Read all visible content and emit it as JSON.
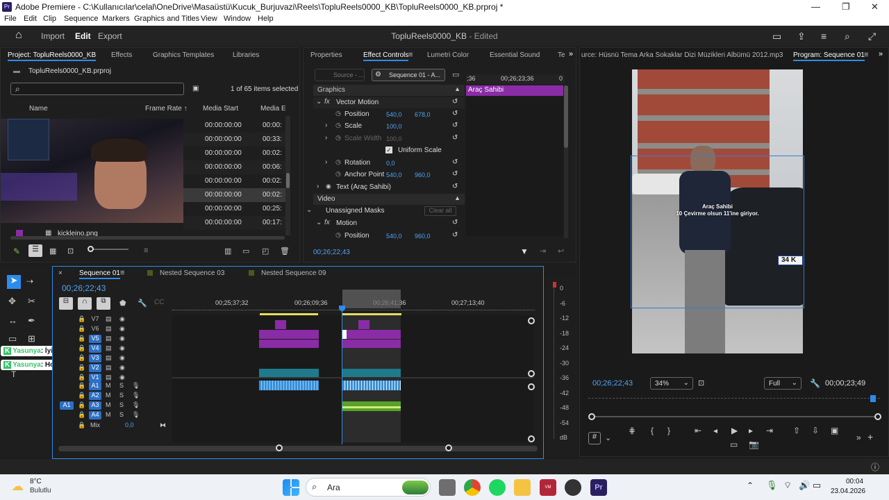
{
  "window": {
    "title": "Adobe Premiere - C:\\Kullanıcılar\\celal\\OneDrive\\Masaüstü\\Kucuk_Burjuvazi\\Reels\\TopluReels0000_KB\\TopluReels0000_KB.prproj *",
    "app_badge": "Pr"
  },
  "menu": [
    "File",
    "Edit",
    "Clip",
    "Sequence",
    "Markers",
    "Graphics and Titles",
    "View",
    "Window",
    "Help"
  ],
  "header": {
    "nav": [
      "Import",
      "Edit",
      "Export"
    ],
    "active": "Edit",
    "project_title": "TopluReels0000_KB",
    "status": " - Edited"
  },
  "project_panel": {
    "tabs": [
      "Project: TopluReels0000_KB",
      "Effects",
      "Graphics Templates",
      "Libraries"
    ],
    "file": "TopluReels0000_KB.prproj",
    "items_selected": "1 of 65 items selected",
    "columns": [
      "Name",
      "Frame Rate",
      "Media Start",
      "Media End"
    ],
    "rows": [
      {
        "start": "00:00:00:00",
        "end": "00:00:"
      },
      {
        "start": "00:00:00:00",
        "end": "00:33:"
      },
      {
        "start": "00:00:00:00",
        "end": "00:02:"
      },
      {
        "start": "00:00:00:00",
        "end": "00:06:"
      },
      {
        "start": "00:00:00:00",
        "end": "00:02:"
      },
      {
        "start": "00:00:00:00",
        "end": "00:02:"
      },
      {
        "start": "00:00:00:00",
        "end": "00:25:"
      },
      {
        "start": "00:00:00:00",
        "end": "00:17:"
      }
    ],
    "last_item": "kickleino.png"
  },
  "effect_controls": {
    "tabs": [
      "Properties",
      "Effect Controls",
      "Lumetri Color",
      "Essential Sound",
      "Te"
    ],
    "source_btn": "Source - ...",
    "sequence_btn": "Sequence 01 - A...",
    "timecode_ruler": "00;26;23;36",
    "ruler_left": ";36",
    "ruler_right": "0",
    "clip_label": "Araç Sahibi",
    "sections": {
      "graphics": "Graphics",
      "vector_motion": "Vector Motion",
      "position_label": "Position",
      "position_x": "540,0",
      "position_y": "678,0",
      "scale_label": "Scale",
      "scale_value": "100,0",
      "scale_width_label": "Scale Width",
      "scale_width_value": "100,0",
      "uniform_scale": "Uniform Scale",
      "rotation_label": "Rotation",
      "rotation_value": "0,0",
      "anchor_label": "Anchor Point",
      "anchor_x": "540,0",
      "anchor_y": "960,0",
      "text_layer": "Text (Araç Sahibi)",
      "video": "Video",
      "unassigned_masks": "Unassigned Masks",
      "clear_all": "Clear all",
      "motion": "Motion",
      "motion_position_label": "Position",
      "motion_position_x": "540,0",
      "motion_position_y": "960,0"
    },
    "current_time": "00;26;22;43"
  },
  "program_monitor": {
    "source_tab": "urce: Hüsnü Tema  Arka Sokaklar Dizi Müzikleri Albümü  2012.mp3",
    "tab": "Program: Sequence 01",
    "overlay_title": "Araç Sahibi",
    "overlay_subtitle": "10 Çevirme olsun 11'ine giriyor.",
    "plate": "34 K",
    "timecode": "00;26;22;43",
    "zoom": "34%",
    "quality": "Full",
    "duration": "00;00;23;49"
  },
  "timeline": {
    "tabs": [
      "Sequence 01",
      "Nested Sequence 03",
      "Nested Sequence 09"
    ],
    "timecode": "00;26;22;43",
    "ruler": [
      "00;25;37;32",
      "00;26;09;36",
      "00;26;41;36",
      "00;27;13;40"
    ],
    "video_tracks": [
      "V7",
      "V6",
      "V5",
      "V4",
      "V3",
      "V2",
      "V1"
    ],
    "audio_tracks": [
      "A1",
      "A2",
      "A3",
      "A4"
    ],
    "mix_label": "Mix",
    "mix_value": "0,0",
    "source_patch": "A1",
    "meter_scale": [
      "0",
      "-6",
      "-12",
      "-18",
      "-24",
      "-30",
      "-36",
      "-42",
      "-48",
      "-54",
      "dB"
    ]
  },
  "chat_overlay": [
    {
      "name": "Yasunya",
      "msg": ": İyi yayınlar hocam"
    },
    {
      "name": "Yasunya",
      "msg": ": Hoş buldum"
    }
  ],
  "taskbar": {
    "weather_temp": "8°C",
    "weather_desc": "Bulutlu",
    "search": "Ara",
    "time": "00:04",
    "date": "23.04.2026"
  },
  "colors": {
    "accent": "#2d8ceb",
    "clip_purple": "#8a2ca6",
    "clip_teal": "#1f7a8c",
    "clip_green": "#8cc63f",
    "audio_blue": "#3a8ed6"
  }
}
